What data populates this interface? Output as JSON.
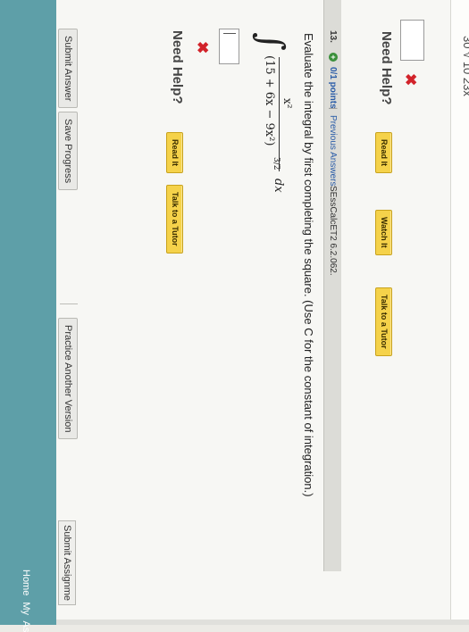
{
  "prev_question": {
    "clipped_text": "30  √ 10  23x",
    "need_help_label": "Need Help?",
    "read_label": "Read It",
    "watch_label": "Watch It",
    "tutor_label": "Talk to a Tutor"
  },
  "question": {
    "number": "13.",
    "points": "0/1 points",
    "separator": "|",
    "previous_answers": "Previous Answers",
    "code": "SEssCalcET2 6.2.062.",
    "prompt": "Evaluate the integral by first completing the square. (Use C for the constant of integration.)",
    "integral": {
      "numerator": "x²",
      "denominator": "(15 + 6x − 9x²)",
      "exponent": "3/2",
      "differential": "dx"
    },
    "answer_value": "",
    "need_help_label": "Need Help?",
    "read_label": "Read It",
    "tutor_label": "Talk to a Tutor"
  },
  "actions": {
    "submit_answer": "Submit Answer",
    "save_progress": "Save Progress",
    "practice_another": "Practice Another Version"
  },
  "footer": {
    "submit_assignment": "Submit Assignme",
    "home_links": "Home  My As"
  },
  "colors": {
    "wrong_mark": "#d2232a",
    "help_button": "#f5d24a",
    "bottom_band": "#5e9fa8",
    "link_blue": "#2a5ca8"
  },
  "icons": [
    "x-mark-icon",
    "plus-circle-icon",
    "integral-sign-icon"
  ]
}
